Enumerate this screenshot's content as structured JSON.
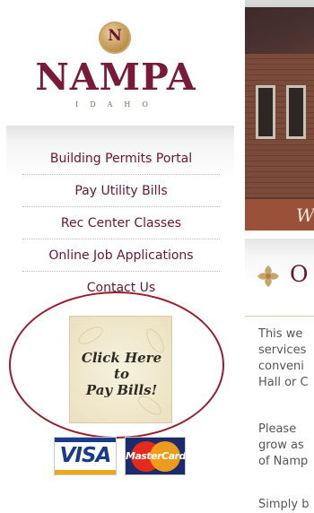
{
  "logo": {
    "seal_letter": "N",
    "name": "NAMPA",
    "state": "IDAHO",
    "brand_color": "#7a1a3a",
    "accent_gold": "#b88a45"
  },
  "nav": {
    "items": [
      {
        "label": "Building Permits Portal"
      },
      {
        "label": "Pay Utility Bills"
      },
      {
        "label": "Rec Center Classes"
      },
      {
        "label": "Online Job Applications"
      },
      {
        "label": "Contact Us"
      }
    ],
    "link_color": "#6b1530"
  },
  "pay_bills": {
    "line1": "Click Here",
    "line2": "to",
    "line3": "Pay Bills!",
    "ring_color": "#9b1c2a"
  },
  "cards": {
    "visa": "VISA",
    "mastercard": "MasterCard"
  },
  "hero": {
    "caption": "W"
  },
  "section": {
    "icon": "fleur-ornament-icon",
    "heading": "O",
    "paragraphs": [
      {
        "lines": [
          "This we",
          "services",
          "conveni",
          "Hall or C"
        ]
      },
      {
        "lines": [
          "Please",
          "grow as",
          "of Namp"
        ]
      },
      {
        "lines": [
          "Simply b"
        ]
      }
    ]
  }
}
